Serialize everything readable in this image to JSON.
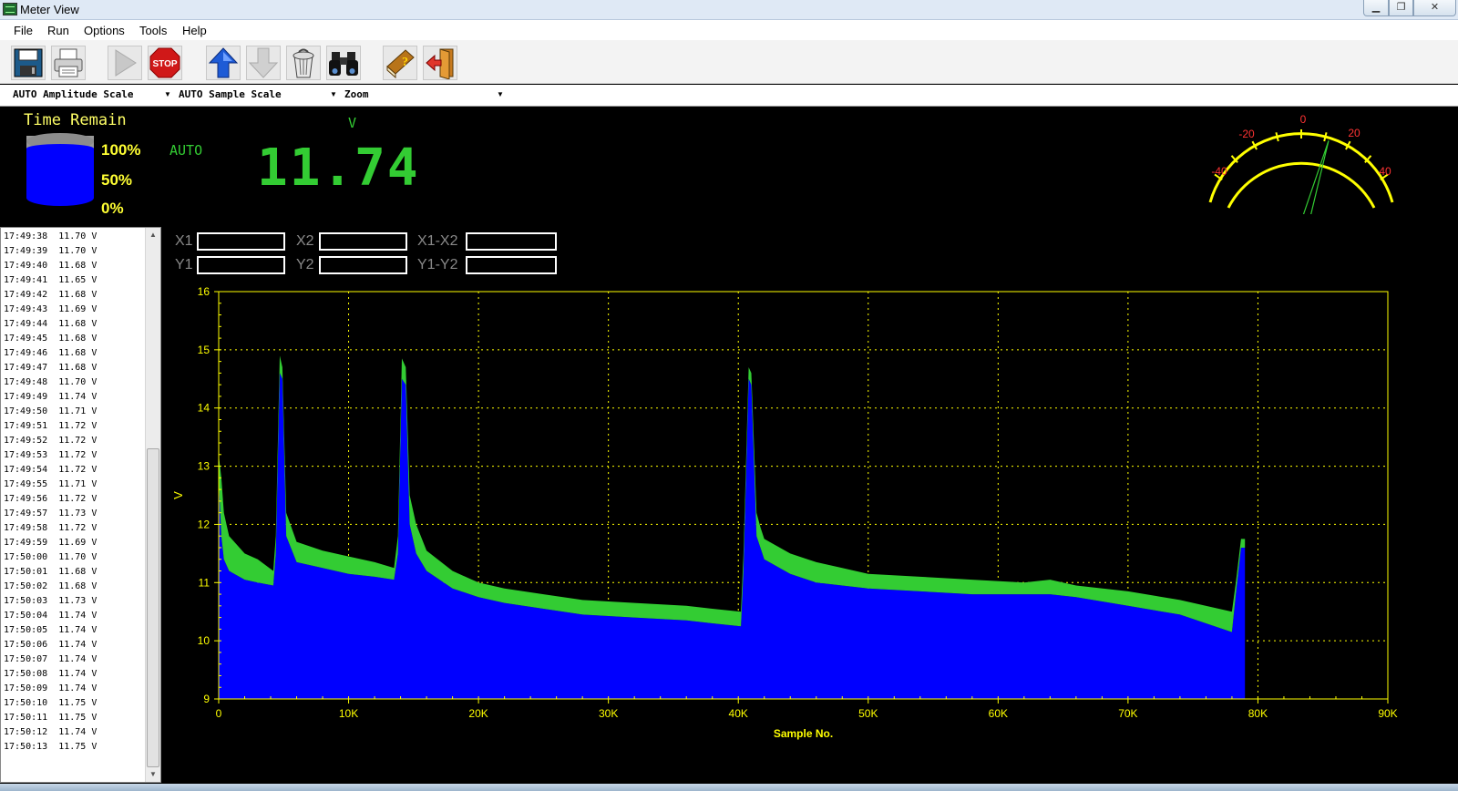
{
  "window": {
    "title": "Meter View",
    "minimize": "▁",
    "maximize": "❐",
    "close": "✕"
  },
  "menu": [
    "File",
    "Run",
    "Options",
    "Tools",
    "Help"
  ],
  "toolbar": {
    "stop_label": "STOP",
    "buttons": [
      "save-icon",
      "print-icon",
      "play-icon",
      "stop-icon",
      "arrow-up-icon",
      "arrow-down-icon",
      "trash-icon",
      "binoculars-icon",
      "help-book-icon",
      "exit-icon"
    ]
  },
  "combos": {
    "amplitude": "AUTO Amplitude Scale",
    "sample": "AUTO Sample Scale",
    "zoom": "Zoom"
  },
  "readout": {
    "time_remain_label": "Time Remain",
    "pct_100": "100%",
    "pct_50": "50%",
    "pct_0": "0%",
    "battery_level": 1.0,
    "auto": "AUTO",
    "unit": "V",
    "value": "11.74"
  },
  "gauge": {
    "ticks": [
      "-40",
      "-20",
      "0",
      "20",
      "40"
    ],
    "needle_value": 11.74
  },
  "log": [
    "17:49:38  11.70 V",
    "17:49:39  11.70 V",
    "17:49:40  11.68 V",
    "17:49:41  11.65 V",
    "17:49:42  11.68 V",
    "17:49:43  11.69 V",
    "17:49:44  11.68 V",
    "17:49:45  11.68 V",
    "17:49:46  11.68 V",
    "17:49:47  11.68 V",
    "17:49:48  11.70 V",
    "17:49:49  11.74 V",
    "17:49:50  11.71 V",
    "17:49:51  11.72 V",
    "17:49:52  11.72 V",
    "17:49:53  11.72 V",
    "17:49:54  11.72 V",
    "17:49:55  11.71 V",
    "17:49:56  11.72 V",
    "17:49:57  11.73 V",
    "17:49:58  11.72 V",
    "17:49:59  11.69 V",
    "17:50:00  11.70 V",
    "17:50:01  11.68 V",
    "17:50:02  11.68 V",
    "17:50:03  11.73 V",
    "17:50:04  11.74 V",
    "17:50:05  11.74 V",
    "17:50:06  11.74 V",
    "17:50:07  11.74 V",
    "17:50:08  11.74 V",
    "17:50:09  11.74 V",
    "17:50:10  11.75 V",
    "17:50:11  11.75 V",
    "17:50:12  11.74 V",
    "17:50:13  11.75 V"
  ],
  "cursors": {
    "x1": "X1",
    "x2": "X2",
    "x1x2": "X1-X2",
    "y1": "Y1",
    "y2": "Y2",
    "y1y2": "Y1-Y2",
    "x1_value": "",
    "x2_value": "",
    "x1x2_value": "",
    "y1_value": "",
    "y2_value": "",
    "y1y2_value": ""
  },
  "colors": {
    "axis": "#ffff00",
    "fill": "#0000ff",
    "trace": "#33cc33",
    "gauge": "#ffff00",
    "gauge_label": "#ff3333"
  },
  "chart_data": {
    "type": "area",
    "xlabel": "Sample No.",
    "ylabel": "V",
    "xlim": [
      0,
      90000
    ],
    "ylim": [
      9,
      16
    ],
    "xticks": [
      "0",
      "10K",
      "20K",
      "30K",
      "40K",
      "50K",
      "60K",
      "70K",
      "80K",
      "90K"
    ],
    "yticks": [
      "9",
      "10",
      "11",
      "12",
      "13",
      "14",
      "15",
      "16"
    ],
    "grid": true,
    "series": [
      {
        "x": [
          0,
          200,
          400,
          800,
          2000,
          3000,
          4200,
          4400,
          4700,
          4900,
          5200,
          6000,
          8000,
          10000,
          12000,
          13500,
          13800,
          14100,
          14400,
          14700,
          15200,
          16000,
          18000,
          20000,
          22000,
          25000,
          28000,
          32000,
          36000,
          38000,
          40200,
          40400,
          40800,
          41000,
          41400,
          41700,
          42000,
          44000,
          46000,
          48000,
          50000,
          54000,
          58000,
          62000,
          64000,
          66000,
          70000,
          74000,
          78000,
          78300,
          78700,
          79000
        ],
        "upper": [
          13.2,
          12.8,
          12.2,
          11.8,
          11.5,
          11.4,
          11.2,
          11.8,
          14.9,
          14.7,
          12.2,
          11.7,
          11.55,
          11.45,
          11.35,
          11.25,
          11.8,
          14.85,
          14.7,
          12.5,
          12.0,
          11.55,
          11.2,
          11.0,
          10.9,
          10.8,
          10.7,
          10.65,
          10.6,
          10.55,
          10.5,
          11.5,
          14.7,
          14.6,
          12.2,
          11.95,
          11.75,
          11.5,
          11.35,
          11.25,
          11.15,
          11.1,
          11.05,
          11.0,
          11.05,
          10.95,
          10.85,
          10.7,
          10.5,
          11.0,
          11.75,
          11.75
        ],
        "lower": [
          12.8,
          11.8,
          11.4,
          11.2,
          11.05,
          11.0,
          10.95,
          11.5,
          14.6,
          14.5,
          11.8,
          11.35,
          11.25,
          11.15,
          11.1,
          11.05,
          11.5,
          14.5,
          14.4,
          12.0,
          11.5,
          11.2,
          10.9,
          10.75,
          10.65,
          10.55,
          10.45,
          10.4,
          10.35,
          10.3,
          10.25,
          11.2,
          14.5,
          14.4,
          11.8,
          11.6,
          11.4,
          11.15,
          11.0,
          10.95,
          10.9,
          10.85,
          10.8,
          10.8,
          10.8,
          10.75,
          10.6,
          10.45,
          10.15,
          10.8,
          11.6,
          11.6
        ]
      }
    ]
  }
}
